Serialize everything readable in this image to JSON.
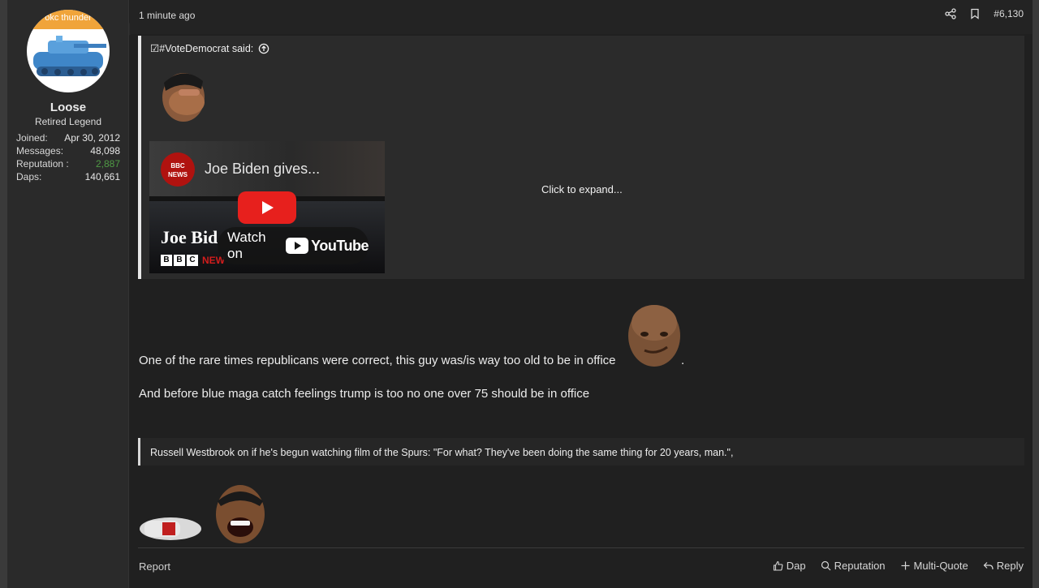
{
  "user": {
    "avatar_banner": "okc thunder",
    "name": "Loose",
    "title": "Retired Legend",
    "stats": [
      {
        "label": "Joined:",
        "value": "Apr 30, 2012"
      },
      {
        "label": "Messages:",
        "value": "48,098"
      },
      {
        "label": "Reputation :",
        "value": "2,887"
      },
      {
        "label": "Daps:",
        "value": "140,661"
      }
    ]
  },
  "post": {
    "time": "1 minute ago",
    "number": "#6,130",
    "quote": {
      "author_said": "☑#VoteDemocrat said:",
      "video": {
        "badge": "BBC NEWS",
        "title": "Joe Biden gives...",
        "overlay_title": "Joe Bid",
        "bbc_letters": [
          "B",
          "B",
          "C"
        ],
        "bbc_news": "NEW",
        "watch_on": "Watch on",
        "youtube": "YouTube"
      },
      "expand": "Click to expand..."
    },
    "body_line1": "One of the rare times republicans were correct, this guy was/is way too old to be in office",
    "body_line1_end": ".",
    "body_line2": "And before blue maga catch feelings trump is too no one over 75 should be in office",
    "signature": "Russell Westbrook on if he's begun watching film of the Spurs: \"For what? They've been doing the same thing for 20 years, man.\","
  },
  "footer": {
    "report": "Report",
    "dap": "Dap",
    "reputation": "Reputation",
    "multiquote": "Multi-Quote",
    "reply": "Reply"
  },
  "colors": {
    "background": "#202020",
    "sidebar": "#2a2a2a",
    "quote_bg": "#2b2b2b",
    "reputation_positive": "#4f9a44",
    "avatar_banner": "#f0a43a",
    "youtube_red": "#e7201d"
  }
}
